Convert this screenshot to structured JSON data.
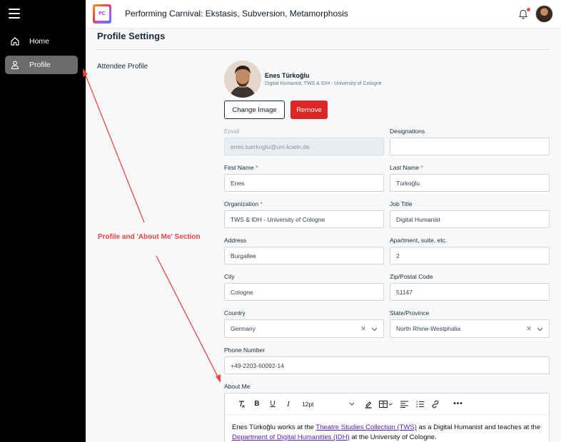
{
  "header": {
    "app_title": "Performing Carnival: Ekstasis, Subversion, Metamorphosis",
    "logo_text": "PC"
  },
  "sidebar": {
    "items": [
      {
        "label": "Home",
        "icon": "home-icon"
      },
      {
        "label": "Profile",
        "icon": "user-icon",
        "active": true
      }
    ]
  },
  "page": {
    "title": "Profile Settings",
    "section_label": "Attendee Profile"
  },
  "profile": {
    "name": "Enes Türkoğlu",
    "role": "Digital Humanist, TWS & IDH - University of Cologne",
    "change_image_label": "Change Image",
    "remove_label": "Remove"
  },
  "form": {
    "email": {
      "label": "Email",
      "value": "enes.tuerkoglu@uni-koeln.de"
    },
    "designations": {
      "label": "Designations",
      "value": ""
    },
    "first_name": {
      "label": "First Name",
      "value": "Enes"
    },
    "last_name": {
      "label": "Last Name",
      "value": "Türkoğlu"
    },
    "organization": {
      "label": "Organization",
      "value": "TWS & IDH - University of Cologne"
    },
    "job_title": {
      "label": "Job Title",
      "value": "Digital Humanist"
    },
    "address": {
      "label": "Address",
      "value": "Burgallee"
    },
    "apartment": {
      "label": "Apartment, suite, etc.",
      "value": "2"
    },
    "city": {
      "label": "City",
      "value": "Cologne"
    },
    "zip": {
      "label": "Zip/Postal Code",
      "value": "51147"
    },
    "country": {
      "label": "Country",
      "value": "Germany"
    },
    "state": {
      "label": "State/Province",
      "value": "North Rhine-Westphalia"
    },
    "phone": {
      "label": "Phone Number",
      "value": "+49-2203-60092-14"
    },
    "required_mark": "*"
  },
  "about": {
    "label": "About Me",
    "font_size": "12pt",
    "text_1": "Enes Türkoğlu works at the ",
    "link_1": "Theatre Studies Collection (TWS)",
    "text_2": " as a Digital Humanist and teaches at the ",
    "link_2": "Department of Digital Humanities (IDH)",
    "text_3": "  at the University of Cologne."
  },
  "annotation": {
    "text": "Profile and 'About Me' Section",
    "color": "#ef4444"
  },
  "colors": {
    "sidebar_bg": "#000000",
    "active_nav": "#6b6b6b",
    "remove_button": "#dc2626",
    "link": "#5b21b6"
  }
}
